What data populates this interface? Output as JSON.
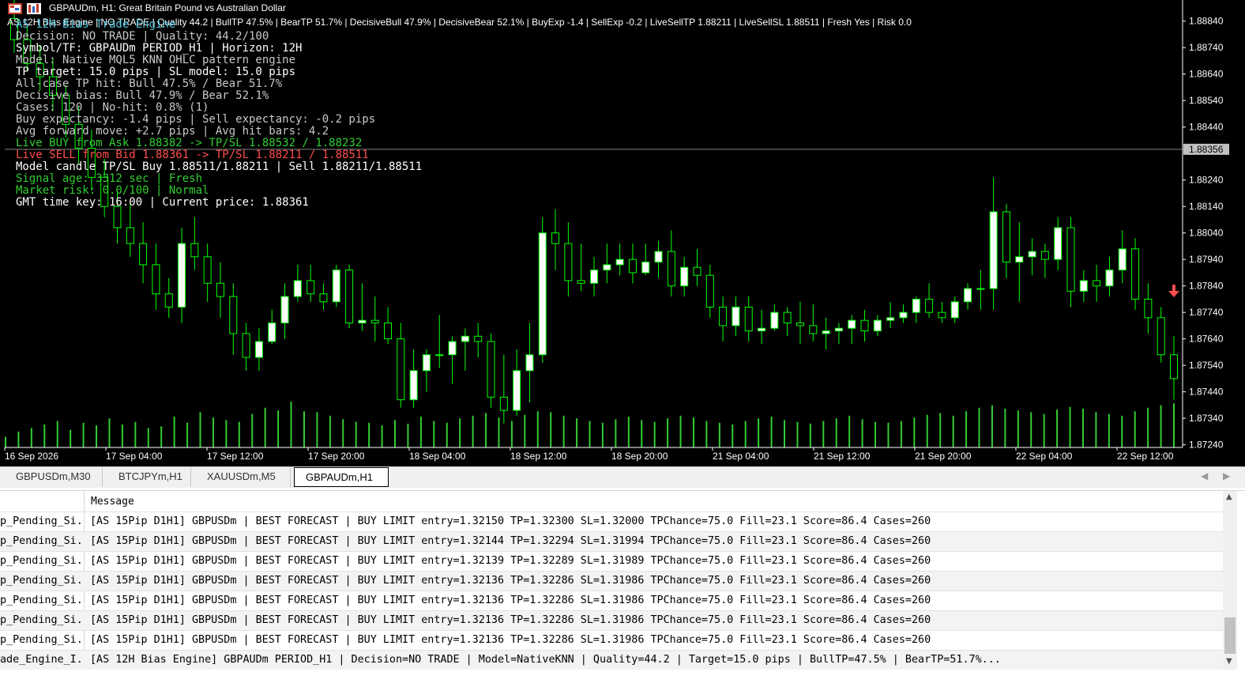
{
  "window": {
    "title": "GBPAUDm, H1:  Great Britain Pound vs Australian Dollar",
    "status_line": "AS 12H Bias Engine | NO TRADE | Quality 44.2 | BullTP 47.5% | BearTP 51.7% | DecisiveBull 47.9% | DecisiveBear 52.1% | BuyExp -1.4 | SellExp -0.2 | LiveSellTP 1.88211 | LiveSellSL 1.88511 | Fresh Yes | Risk 0.0"
  },
  "overlay": {
    "lines": [
      {
        "text": "AS 12H Bias Trade Engine",
        "color": "#4fc3d8"
      },
      {
        "text": "Decision: NO TRADE | Quality: 44.2/100",
        "color": "#c8c8c8"
      },
      {
        "text": "Symbol/TF: GBPAUDm PERIOD_H1 | Horizon: 12H",
        "color": "#ffffff"
      },
      {
        "text": "Model: Native MQL5 KNN OHLC pattern engine",
        "color": "#c8c8c8"
      },
      {
        "text": "TP target: 15.0 pips | SL model: 15.0 pips",
        "color": "#ffffff"
      },
      {
        "text": "All-case TP hit: Bull 47.5% / Bear 51.7%",
        "color": "#c8c8c8"
      },
      {
        "text": "Decisive bias: Bull 47.9% / Bear 52.1%",
        "color": "#c8c8c8"
      },
      {
        "text": "Cases: 120 | No-hit: 0.8% (1)",
        "color": "#c8c8c8"
      },
      {
        "text": "Buy expectancy: -1.4 pips | Sell expectancy: -0.2 pips",
        "color": "#c8c8c8"
      },
      {
        "text": "Avg forward move: +2.7 pips | Avg hit bars: 4.2",
        "color": "#c8c8c8"
      },
      {
        "text": "Live BUY from Ask 1.88382 -> TP/SL 1.88532 / 1.88232",
        "color": "#32cd32"
      },
      {
        "text": "Live SELL from Bid 1.88361 -> TP/SL 1.88211 / 1.88511",
        "color": "#ff4d4d"
      },
      {
        "text": "Model candle TP/SL Buy 1.88511/1.88211 | Sell 1.88211/1.88511",
        "color": "#ffffff"
      },
      {
        "text": "Signal age: 3312 sec | Fresh",
        "color": "#32cd32"
      },
      {
        "text": "Market risk: 0.0/100 | Normal",
        "color": "#32cd32"
      },
      {
        "text": "GMT time key: 16:00 | Current price: 1.88361",
        "color": "#ffffff"
      }
    ]
  },
  "chart_data": {
    "type": "candlestick",
    "symbol": "GBPAUDm",
    "timeframe": "H1",
    "price_axis": [
      "1.88840",
      "1.88740",
      "1.88640",
      "1.88540",
      "1.88440",
      "1.88240",
      "1.88140",
      "1.88040",
      "1.87940",
      "1.87840",
      "1.87740",
      "1.87640",
      "1.87540",
      "1.87440",
      "1.87340",
      "1.87240"
    ],
    "current_price": "1.88356",
    "time_axis": [
      "16 Sep 2026",
      "17 Sep 04:00",
      "17 Sep 12:00",
      "17 Sep 20:00",
      "18 Sep 04:00",
      "18 Sep 12:00",
      "18 Sep 20:00",
      "21 Sep 04:00",
      "21 Sep 12:00",
      "21 Sep 20:00",
      "22 Sep 04:00",
      "22 Sep 12:00"
    ],
    "candles": [
      [
        1.8885,
        1.8895,
        1.8872,
        1.8877
      ],
      [
        1.8877,
        1.8882,
        1.8865,
        1.8868
      ],
      [
        1.8868,
        1.8875,
        1.8858,
        1.8863
      ],
      [
        1.8863,
        1.887,
        1.885,
        1.8856
      ],
      [
        1.8856,
        1.886,
        1.884,
        1.8845
      ],
      [
        1.8845,
        1.8852,
        1.883,
        1.8836
      ],
      [
        1.8836,
        1.8843,
        1.882,
        1.8825
      ],
      [
        1.8825,
        1.8832,
        1.881,
        1.8814
      ],
      [
        1.8814,
        1.882,
        1.88,
        1.8806
      ],
      [
        1.8806,
        1.8815,
        1.8795,
        1.88
      ],
      [
        1.88,
        1.8808,
        1.8785,
        1.8792
      ],
      [
        1.8792,
        1.88,
        1.8775,
        1.8781
      ],
      [
        1.8781,
        1.8787,
        1.8772,
        1.8776
      ],
      [
        1.8776,
        1.8806,
        1.877,
        1.88
      ],
      [
        1.88,
        1.881,
        1.879,
        1.8795
      ],
      [
        1.8795,
        1.88,
        1.8778,
        1.8785
      ],
      [
        1.8785,
        1.8793,
        1.8772,
        1.878
      ],
      [
        1.878,
        1.8785,
        1.8758,
        1.8766
      ],
      [
        1.8766,
        1.877,
        1.8752,
        1.8757
      ],
      [
        1.8757,
        1.8768,
        1.8752,
        1.8763
      ],
      [
        1.8763,
        1.8775,
        1.8762,
        1.877
      ],
      [
        1.877,
        1.8785,
        1.8764,
        1.878
      ],
      [
        1.878,
        1.8792,
        1.8778,
        1.8786
      ],
      [
        1.8786,
        1.8792,
        1.8778,
        1.8781
      ],
      [
        1.8781,
        1.8785,
        1.8775,
        1.8778
      ],
      [
        1.8778,
        1.8792,
        1.8776,
        1.879
      ],
      [
        1.879,
        1.8792,
        1.8768,
        1.877
      ],
      [
        1.877,
        1.8785,
        1.8767,
        1.8771
      ],
      [
        1.8771,
        1.878,
        1.8763,
        1.877
      ],
      [
        1.877,
        1.8776,
        1.8762,
        1.8764
      ],
      [
        1.8764,
        1.877,
        1.8738,
        1.8741
      ],
      [
        1.8741,
        1.876,
        1.8738,
        1.8752
      ],
      [
        1.8752,
        1.876,
        1.8744,
        1.8758
      ],
      [
        1.8758,
        1.8773,
        1.8753,
        1.8758
      ],
      [
        1.8758,
        1.8765,
        1.8747,
        1.8763
      ],
      [
        1.8763,
        1.8768,
        1.8752,
        1.8765
      ],
      [
        1.8765,
        1.877,
        1.8757,
        1.8763
      ],
      [
        1.8763,
        1.8766,
        1.8738,
        1.8742
      ],
      [
        1.8742,
        1.8758,
        1.8732,
        1.8737
      ],
      [
        1.8737,
        1.876,
        1.8735,
        1.8752
      ],
      [
        1.8752,
        1.877,
        1.874,
        1.8758
      ],
      [
        1.8758,
        1.881,
        1.8755,
        1.8804
      ],
      [
        1.8804,
        1.8813,
        1.879,
        1.88
      ],
      [
        1.88,
        1.8808,
        1.878,
        1.8786
      ],
      [
        1.8786,
        1.88,
        1.8782,
        1.8785
      ],
      [
        1.8785,
        1.8795,
        1.878,
        1.879
      ],
      [
        1.879,
        1.88,
        1.8785,
        1.8792
      ],
      [
        1.8792,
        1.88,
        1.8788,
        1.8794
      ],
      [
        1.8794,
        1.88,
        1.8785,
        1.8789
      ],
      [
        1.8789,
        1.88,
        1.8788,
        1.8793
      ],
      [
        1.8793,
        1.8801,
        1.8787,
        1.8797
      ],
      [
        1.8797,
        1.8805,
        1.878,
        1.8784
      ],
      [
        1.8784,
        1.8795,
        1.878,
        1.8791
      ],
      [
        1.8791,
        1.8798,
        1.8784,
        1.8788
      ],
      [
        1.8788,
        1.8792,
        1.8772,
        1.8776
      ],
      [
        1.8776,
        1.878,
        1.8763,
        1.8769
      ],
      [
        1.8769,
        1.878,
        1.8765,
        1.8776
      ],
      [
        1.8776,
        1.878,
        1.8763,
        1.8767
      ],
      [
        1.8767,
        1.8775,
        1.8762,
        1.8768
      ],
      [
        1.8768,
        1.8777,
        1.8767,
        1.8774
      ],
      [
        1.8774,
        1.8776,
        1.8765,
        1.877
      ],
      [
        1.877,
        1.8778,
        1.8762,
        1.8769
      ],
      [
        1.8769,
        1.8777,
        1.8763,
        1.8766
      ],
      [
        1.8766,
        1.8772,
        1.876,
        1.8767
      ],
      [
        1.8767,
        1.877,
        1.8762,
        1.8768
      ],
      [
        1.8768,
        1.8773,
        1.8762,
        1.8771
      ],
      [
        1.8771,
        1.8775,
        1.8763,
        1.8767
      ],
      [
        1.8767,
        1.8773,
        1.8765,
        1.8771
      ],
      [
        1.8771,
        1.8778,
        1.8768,
        1.8772
      ],
      [
        1.8772,
        1.8777,
        1.877,
        1.8774
      ],
      [
        1.8774,
        1.878,
        1.877,
        1.8779
      ],
      [
        1.8779,
        1.8785,
        1.8772,
        1.8774
      ],
      [
        1.8774,
        1.8778,
        1.877,
        1.8772
      ],
      [
        1.8772,
        1.878,
        1.877,
        1.8778
      ],
      [
        1.8778,
        1.8785,
        1.8775,
        1.8783
      ],
      [
        1.8783,
        1.879,
        1.8775,
        1.8783
      ],
      [
        1.8783,
        1.8825,
        1.8775,
        1.8812
      ],
      [
        1.8812,
        1.8815,
        1.8787,
        1.8793
      ],
      [
        1.8793,
        1.8808,
        1.8778,
        1.8795
      ],
      [
        1.8795,
        1.8802,
        1.8788,
        1.8797
      ],
      [
        1.8797,
        1.88,
        1.8787,
        1.8794
      ],
      [
        1.8794,
        1.881,
        1.879,
        1.8806
      ],
      [
        1.8806,
        1.881,
        1.8776,
        1.8782
      ],
      [
        1.8782,
        1.879,
        1.8778,
        1.8786
      ],
      [
        1.8786,
        1.8792,
        1.8778,
        1.8784
      ],
      [
        1.8784,
        1.8795,
        1.878,
        1.879
      ],
      [
        1.879,
        1.8805,
        1.8785,
        1.8798
      ],
      [
        1.8798,
        1.8802,
        1.8775,
        1.8779
      ],
      [
        1.8779,
        1.8785,
        1.8766,
        1.8772
      ],
      [
        1.8772,
        1.8776,
        1.8755,
        1.8758
      ],
      [
        1.8758,
        1.8765,
        1.8741,
        1.8749
      ]
    ],
    "volumes": [
      12,
      18,
      22,
      26,
      30,
      20,
      28,
      25,
      33,
      26,
      29,
      22,
      24,
      35,
      28,
      40,
      34,
      31,
      29,
      38,
      45,
      42,
      52,
      41,
      40,
      36,
      32,
      29,
      28,
      25,
      31,
      27,
      35,
      30,
      28,
      33,
      36,
      39,
      34,
      30,
      37,
      41,
      40,
      36,
      33,
      30,
      28,
      32,
      35,
      31,
      29,
      33,
      36,
      34,
      30,
      28,
      26,
      30,
      33,
      35,
      31,
      29,
      27,
      30,
      33,
      36,
      32,
      29,
      28,
      30,
      34,
      37,
      39,
      36,
      41,
      45,
      48,
      44,
      42,
      40,
      38,
      43,
      46,
      44,
      40,
      38,
      36,
      41,
      45,
      48,
      50
    ]
  },
  "tabs": [
    {
      "label": "GBPUSDm,M30",
      "active": false
    },
    {
      "label": "BTCJPYm,H1",
      "active": false
    },
    {
      "label": "XAUUSDm,M5",
      "active": false
    },
    {
      "label": "GBPAUDm,H1",
      "active": true
    }
  ],
  "log": {
    "header": "Message",
    "rows": [
      {
        "source": "p_Pending_Si...",
        "message": "[AS 15Pip D1H1] GBPUSDm | BEST FORECAST | BUY LIMIT entry=1.32150 TP=1.32300 SL=1.32000 TPChance=75.0 Fill=23.1 Score=86.4 Cases=260"
      },
      {
        "source": "p_Pending_Si...",
        "message": "[AS 15Pip D1H1] GBPUSDm | BEST FORECAST | BUY LIMIT entry=1.32144 TP=1.32294 SL=1.31994 TPChance=75.0 Fill=23.1 Score=86.4 Cases=260"
      },
      {
        "source": "p_Pending_Si...",
        "message": "[AS 15Pip D1H1] GBPUSDm | BEST FORECAST | BUY LIMIT entry=1.32139 TP=1.32289 SL=1.31989 TPChance=75.0 Fill=23.1 Score=86.4 Cases=260"
      },
      {
        "source": "p_Pending_Si...",
        "message": "[AS 15Pip D1H1] GBPUSDm | BEST FORECAST | BUY LIMIT entry=1.32136 TP=1.32286 SL=1.31986 TPChance=75.0 Fill=23.1 Score=86.4 Cases=260"
      },
      {
        "source": "p_Pending_Si...",
        "message": "[AS 15Pip D1H1] GBPUSDm | BEST FORECAST | BUY LIMIT entry=1.32136 TP=1.32286 SL=1.31986 TPChance=75.0 Fill=23.1 Score=86.4 Cases=260"
      },
      {
        "source": "p_Pending_Si...",
        "message": "[AS 15Pip D1H1] GBPUSDm | BEST FORECAST | BUY LIMIT entry=1.32136 TP=1.32286 SL=1.31986 TPChance=75.0 Fill=23.1 Score=86.4 Cases=260"
      },
      {
        "source": "p_Pending_Si...",
        "message": "[AS 15Pip D1H1] GBPUSDm | BEST FORECAST | BUY LIMIT entry=1.32136 TP=1.32286 SL=1.31986 TPChance=75.0 Fill=23.1 Score=86.4 Cases=260"
      },
      {
        "source": "ade_Engine_I...",
        "message": "[AS 12H Bias Engine] GBPAUDm PERIOD_H1 | Decision=NO TRADE | Model=NativeKNN | Quality=44.2 | Target=15.0 pips | BullTP=47.5% | BearTP=51.7%..."
      }
    ]
  },
  "colors": {
    "bull": "#ffffff",
    "wick": "#00ff00",
    "volume": "#32cd32",
    "sell_arrow": "#ff4d4d",
    "grid": "#808080"
  },
  "icons": {
    "chart_icon": "chart-window-icon",
    "sell_arrow": "sell-arrow-icon"
  }
}
